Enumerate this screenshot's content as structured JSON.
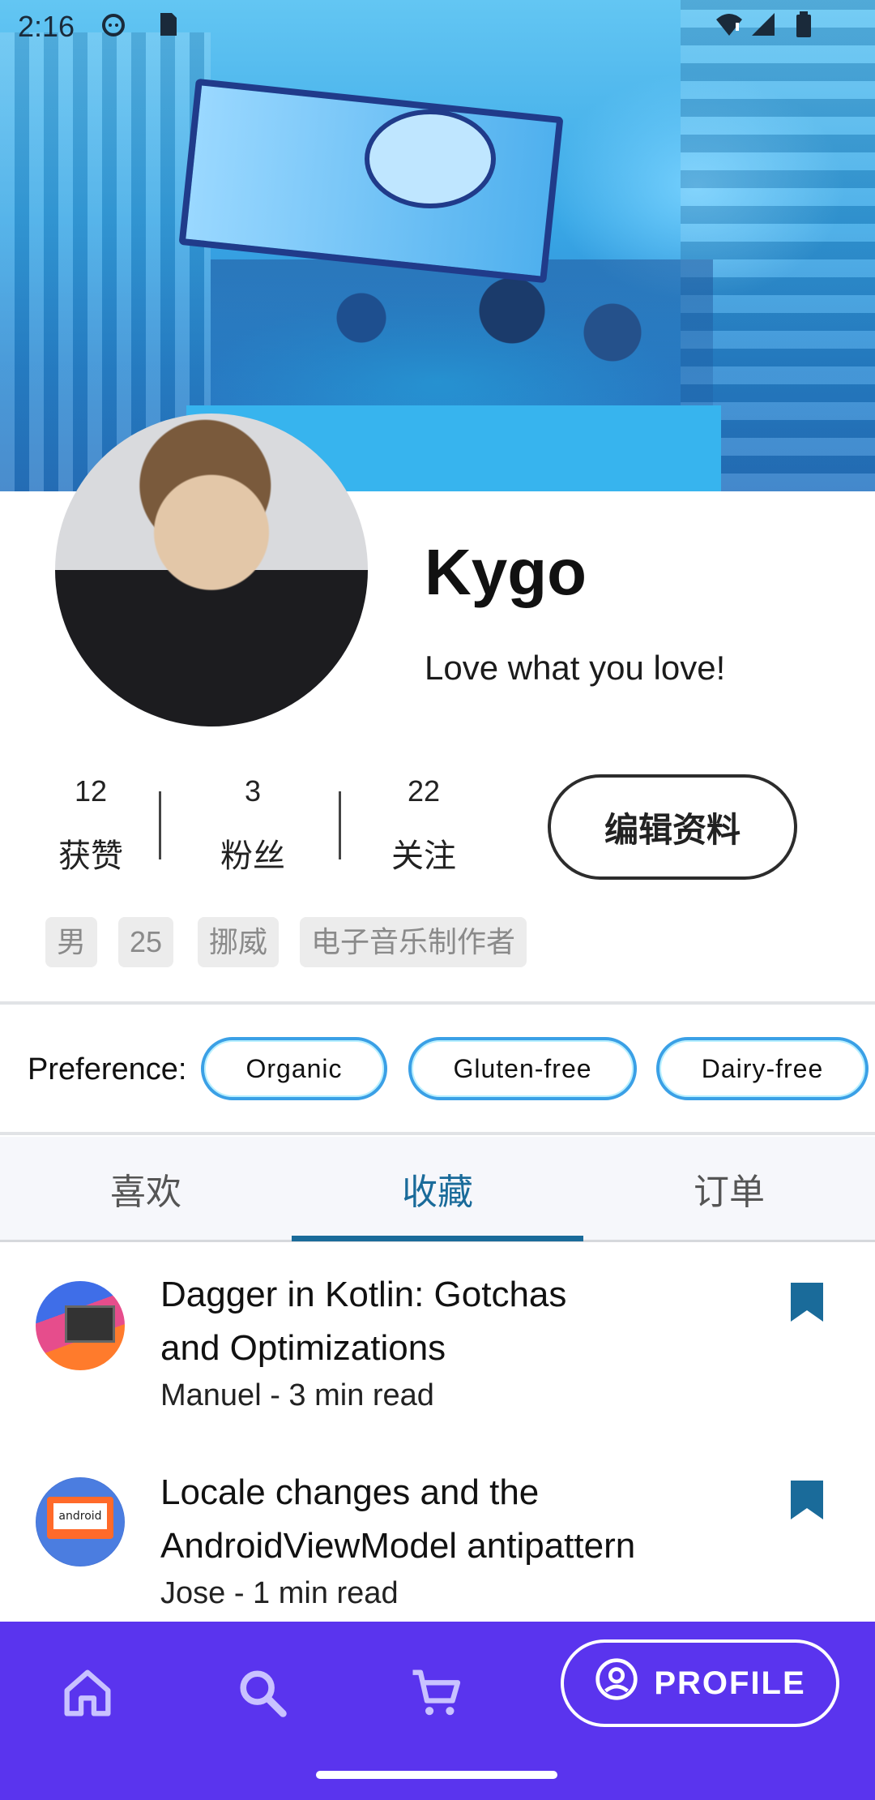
{
  "status_bar": {
    "time": "2:16",
    "icons": [
      "cat-face-icon",
      "sd-card-icon",
      "wifi-icon",
      "cellular-signal-icon",
      "battery-icon"
    ]
  },
  "profile": {
    "name": "Kygo",
    "bio": "Love what you love!",
    "stats": [
      {
        "value": "12",
        "label": "获赞"
      },
      {
        "value": "3",
        "label": "粉丝"
      },
      {
        "value": "22",
        "label": "关注"
      }
    ],
    "edit_button_label": "编辑资料",
    "tags": [
      "男",
      "25",
      "挪威",
      "电子音乐制作者"
    ]
  },
  "preferences": {
    "label": "Preference:",
    "chips": [
      "Organic",
      "Gluten-free",
      "Dairy-free"
    ]
  },
  "tabs": [
    {
      "label": "喜欢",
      "active": false
    },
    {
      "label": "收藏",
      "active": true
    },
    {
      "label": "订单",
      "active": false
    }
  ],
  "articles": [
    {
      "title_line1": "Dagger in Kotlin: Gotchas",
      "title_line2": "and Optimizations",
      "meta": "Manuel - 3 min read",
      "bookmarked": true
    },
    {
      "title_line1": "Locale changes and the",
      "title_line2": "AndroidViewModel antipattern",
      "meta": "Jose - 1 min read",
      "thumb_text": "android",
      "bookmarked": true
    }
  ],
  "bottom_nav": {
    "items": [
      "home-icon",
      "search-icon",
      "cart-icon"
    ],
    "active_label": "PROFILE",
    "active_icon": "account-circle-icon"
  },
  "colors": {
    "accent": "#1a6b9a",
    "nav_background": "#5a34ee",
    "chip_border": "#3aa0e6"
  }
}
